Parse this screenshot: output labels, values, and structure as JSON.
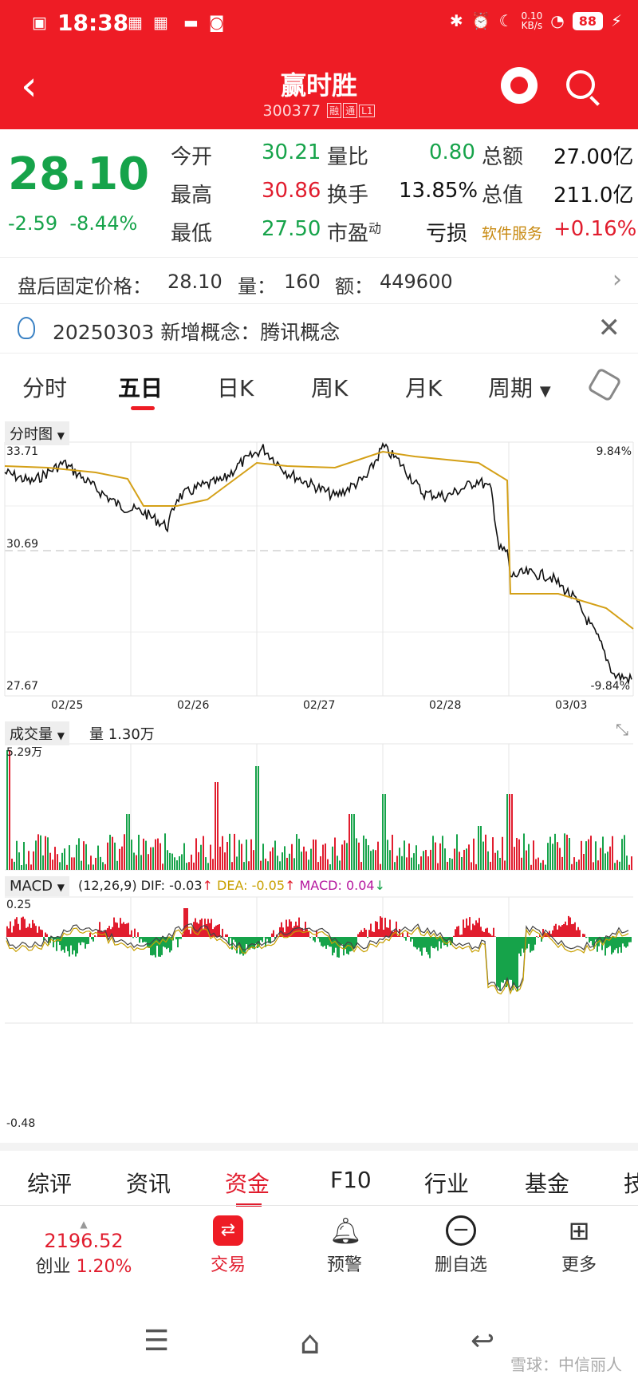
{
  "status": {
    "time": "18:38",
    "net_speed": "0.10",
    "net_unit": "KB/s",
    "battery": "88"
  },
  "header": {
    "title": "赢时胜",
    "code": "300377",
    "tags": [
      "融",
      "通",
      "L1"
    ]
  },
  "quote": {
    "price": "28.10",
    "change": "-2.59",
    "change_pct": "-8.44%",
    "cells": [
      {
        "label": "今开",
        "value": "30.21",
        "color": "green"
      },
      {
        "label": "量比",
        "value": "0.80",
        "color": "green"
      },
      {
        "label": "总额",
        "value": "27.00亿",
        "color": "dark"
      },
      {
        "label": "最高",
        "value": "30.86",
        "color": "red"
      },
      {
        "label": "换手",
        "value": "13.85%",
        "color": "dark"
      },
      {
        "label": "总值",
        "value": "211.0亿",
        "color": "dark"
      },
      {
        "label": "最低",
        "value": "27.50",
        "color": "green"
      },
      {
        "label": "市盈",
        "label_sup": "动",
        "value": "亏损",
        "color": "dark"
      },
      {
        "label": "软件服务",
        "value": "+0.16%",
        "color": "red"
      }
    ]
  },
  "after_hours": {
    "label": "盘后固定价格：",
    "price": "28.10",
    "vol_label": "量：",
    "vol": "160",
    "amt_label": "额：",
    "amt": "449600"
  },
  "concept": {
    "text": "20250303 新增概念：腾讯概念"
  },
  "tabs": [
    "分时",
    "五日",
    "日K",
    "周K",
    "月K",
    "周期"
  ],
  "active_tab": 1,
  "chart": {
    "mode_label": "分时图",
    "y_top": "33.71",
    "y_mid": "30.69",
    "y_bottom": "27.67",
    "pct_top": "9.84%",
    "pct_bottom": "-9.84%",
    "dates": [
      "02/25",
      "02/26",
      "02/27",
      "02/28",
      "03/03"
    ]
  },
  "volume": {
    "label": "成交量",
    "vol_text": "量 1.30万",
    "max_label": "5.29万"
  },
  "macd": {
    "label": "MACD",
    "params": "(12,26,9)",
    "dif": "DIF: -0.03",
    "dea": "DEA: -0.05",
    "macd": "MACD: 0.04",
    "y_top": "0.25",
    "y_bottom": "-0.48"
  },
  "subtabs": [
    "综评",
    "资讯",
    "资金",
    "F10",
    "行业",
    "基金",
    "技"
  ],
  "active_subtab": 2,
  "bottom": {
    "index_value": "2196.52",
    "index_name": "创业",
    "index_pct": "1.20%",
    "trade": "交易",
    "alert": "预警",
    "remove": "删自选",
    "more": "更多"
  },
  "watermark": "雪球：中信丽人",
  "colors": {
    "brand": "#ee1c25",
    "down": "#16a34a",
    "up": "#e11d2e",
    "avg_line": "#d4a017"
  }
}
